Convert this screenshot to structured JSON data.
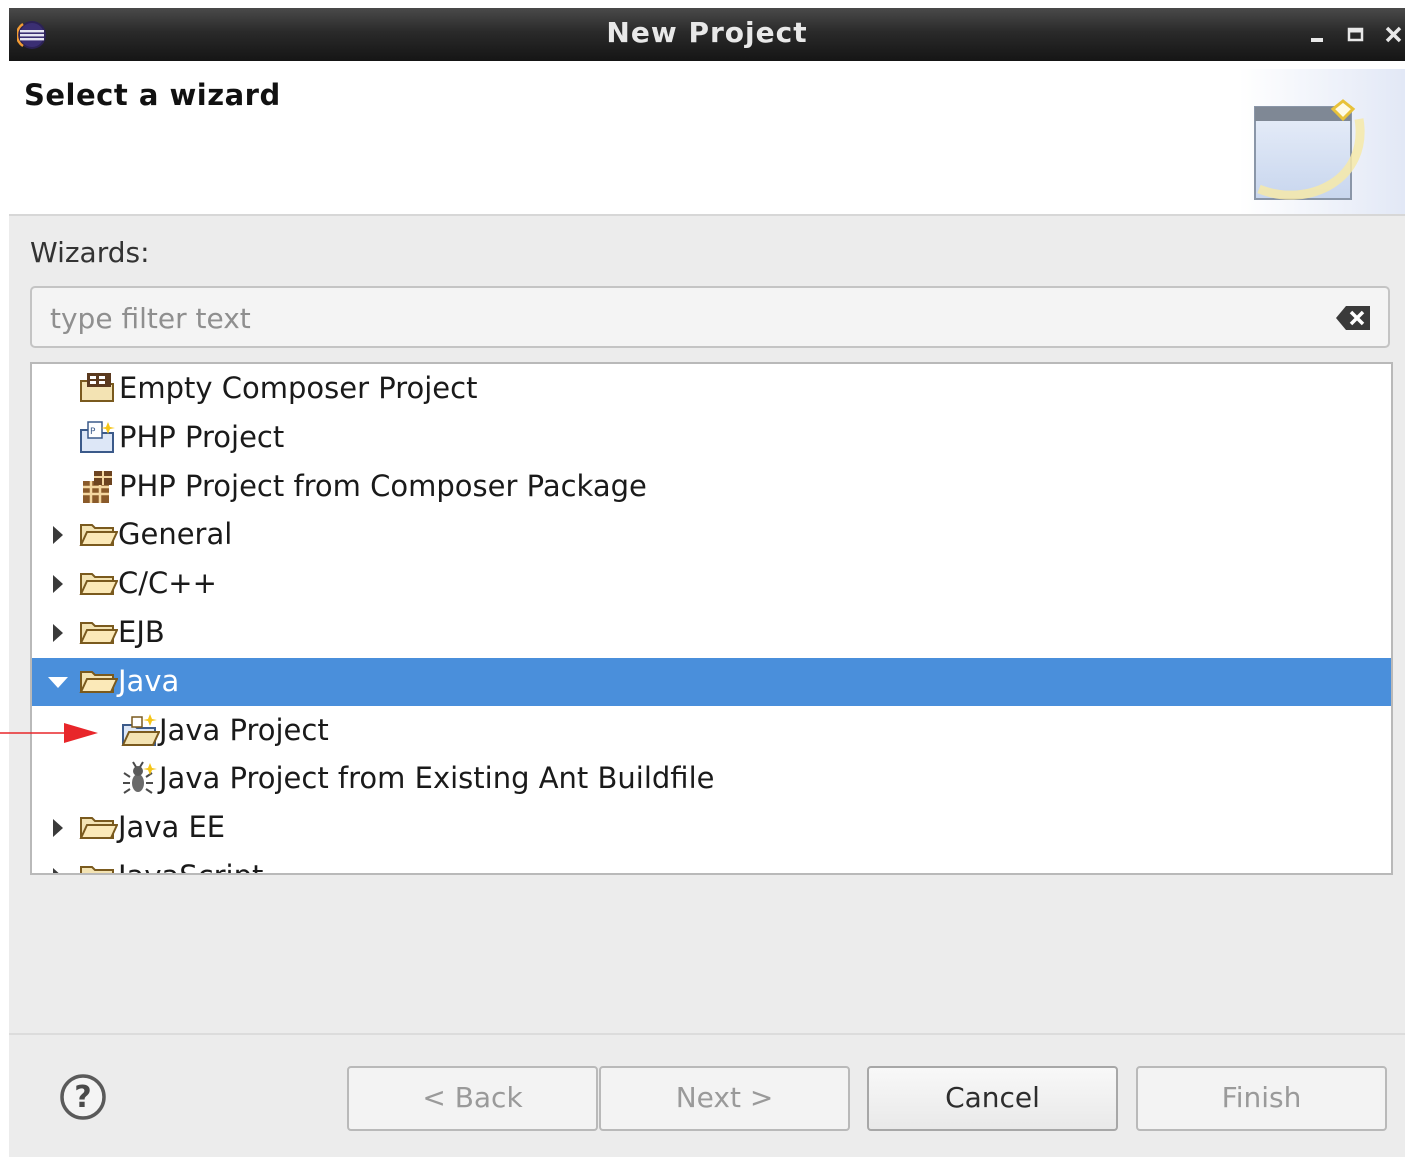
{
  "window": {
    "title": "New Project"
  },
  "header": {
    "title": "Select a wizard"
  },
  "wizards_label": "Wizards:",
  "filter": {
    "placeholder": "type filter text",
    "value": ""
  },
  "tree": {
    "items": [
      {
        "label": "Empty Composer Project",
        "icon": "composer-project-icon",
        "expander": "none",
        "level": 1,
        "selected": false
      },
      {
        "label": "PHP Project",
        "icon": "php-project-icon",
        "expander": "none",
        "level": 1,
        "selected": false
      },
      {
        "label": "PHP Project from Composer Package",
        "icon": "composer-package-icon",
        "expander": "none",
        "level": 1,
        "selected": false
      },
      {
        "label": "General",
        "icon": "folder-icon",
        "expander": "collapsed",
        "level": 0,
        "selected": false
      },
      {
        "label": "C/C++",
        "icon": "folder-icon",
        "expander": "collapsed",
        "level": 0,
        "selected": false
      },
      {
        "label": "EJB",
        "icon": "folder-icon",
        "expander": "collapsed",
        "level": 0,
        "selected": false
      },
      {
        "label": "Java",
        "icon": "folder-icon",
        "expander": "expanded",
        "level": 0,
        "selected": true
      },
      {
        "label": "Java Project",
        "icon": "java-project-icon",
        "expander": "none",
        "level": 2,
        "selected": false
      },
      {
        "label": "Java Project from Existing Ant Buildfile",
        "icon": "ant-buildfile-icon",
        "expander": "none",
        "level": 2,
        "selected": false
      },
      {
        "label": "Java EE",
        "icon": "folder-icon",
        "expander": "collapsed",
        "level": 0,
        "selected": false
      },
      {
        "label": "JavaScript",
        "icon": "folder-icon",
        "expander": "collapsed",
        "level": 0,
        "selected": false
      }
    ]
  },
  "buttons": {
    "back": "< Back",
    "next": "Next >",
    "cancel": "Cancel",
    "finish": "Finish"
  },
  "colors": {
    "selection": "#4a8fdb",
    "annotation_arrow": "#e8262a"
  }
}
